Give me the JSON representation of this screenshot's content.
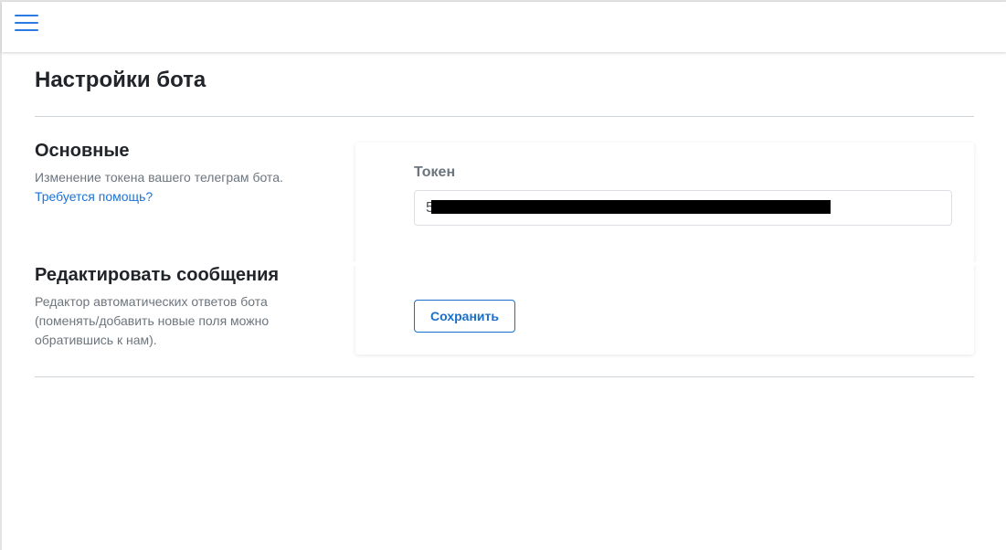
{
  "header": {
    "menu_icon": "hamburger-menu-icon"
  },
  "page": {
    "title": "Настройки бота"
  },
  "sections": {
    "basic": {
      "heading": "Основные",
      "description": "Изменение токена вашего телеграм бота.",
      "help_link": "Требуется помощь?"
    },
    "messages": {
      "heading": "Редактировать сообщения",
      "description": "Редактор автоматических ответов бота (поменять/добавить новые поля можно обратившись к нам)."
    }
  },
  "form": {
    "token_label": "Токен",
    "token_value": "5",
    "save_label": "Сохранить"
  },
  "colors": {
    "accent": "#2c7be5",
    "link": "#1a73d9",
    "button_border": "#1a6fc9",
    "muted_text": "#6c757d",
    "heading_text": "#212529"
  }
}
